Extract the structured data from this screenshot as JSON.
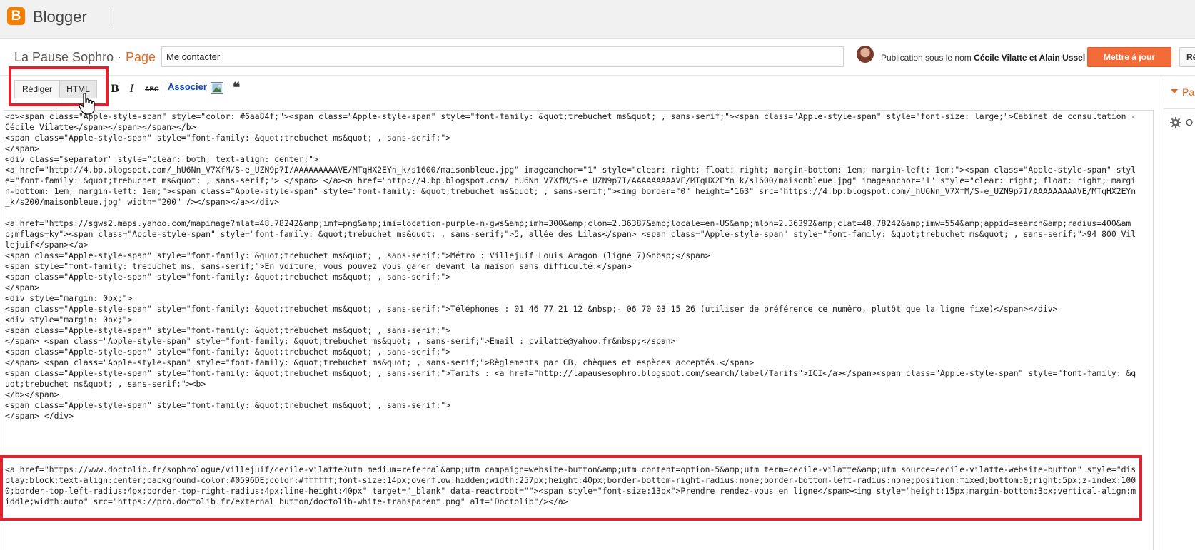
{
  "app": {
    "name": "Blogger",
    "logo_letter": "B"
  },
  "header": {
    "blog_title": "La Pause Sophro",
    "separator": "·",
    "page_label": "Page",
    "page_title_value": "Me contacter",
    "publishing_prefix": "Publication sous le nom ",
    "authors": "Cécile Vilatte et Alain Ussel",
    "update_button": "Mettre à jour",
    "revert_button": "Rétablir"
  },
  "toolbar": {
    "compose_label": "Rédiger",
    "html_label": "HTML",
    "bold": "B",
    "italic": "I",
    "strike": "ABC",
    "link_label": "Associer",
    "quote": "❝"
  },
  "sidebar": {
    "section_label": "Pa",
    "options_label": "O"
  },
  "editor": {
    "html_source_top": "<p><span class=\"Apple-style-span\" style=\"color: #6aa84f;\"><span class=\"Apple-style-span\" style=\"font-family: &quot;trebuchet ms&quot; , sans-serif;\"><span class=\"Apple-style-span\" style=\"font-size: large;\">Cabinet de consultation - Cécile Vilatte</span></span></span></b>\n<span class=\"Apple-style-span\" style=\"font-family: &quot;trebuchet ms&quot; , sans-serif;\">\n</span>\n<div class=\"separator\" style=\"clear: both; text-align: center;\">\n<a href=\"http://4.bp.blogspot.com/_hU6Nn_V7XfM/S-e_UZN9p7I/AAAAAAAAAVE/MTqHX2EYn_k/s1600/maisonbleue.jpg\" imageanchor=\"1\" style=\"clear: right; float: right; margin-bottom: 1em; margin-left: 1em;\"><span class=\"Apple-style-span\" style=\"font-family: &quot;trebuchet ms&quot; , sans-serif;\"> </span> </a><a href=\"http://4.bp.blogspot.com/_hU6Nn_V7XfM/S-e_UZN9p7I/AAAAAAAAAVE/MTqHX2EYn_k/s1600/maisonbleue.jpg\" imageanchor=\"1\" style=\"clear: right; float: right; margin-bottom: 1em; margin-left: 1em;\"><span class=\"Apple-style-span\" style=\"font-family: &quot;trebuchet ms&quot; , sans-serif;\"><img border=\"0\" height=\"163\" src=\"https://4.bp.blogspot.com/_hU6Nn_V7XfM/S-e_UZN9p7I/AAAAAAAAAVE/MTqHX2EYn_k/s200/maisonbleue.jpg\" width=\"200\" /></span></a></div>\n\n<a href=\"https://sgws2.maps.yahoo.com/mapimage?mlat=48.78242&amp;imf=png&amp;imi=location-purple-n-gws&amp;imh=300&amp;clon=2.36387&amp;locale=en-US&amp;mlon=2.36392&amp;clat=48.78242&amp;imw=554&amp;appid=search&amp;radius=400&amp;mflags=ky\"><span class=\"Apple-style-span\" style=\"font-family: &quot;trebuchet ms&quot; , sans-serif;\">5, allée des Lilas</span> <span class=\"Apple-style-span\" style=\"font-family: &quot;trebuchet ms&quot; , sans-serif;\">94 800 Villejuif</span></a>\n<span class=\"Apple-style-span\" style=\"font-family: &quot;trebuchet ms&quot; , sans-serif;\">Métro : Villejuif Louis Aragon (ligne 7)&nbsp;</span>\n<span style=\"font-family: trebuchet ms, sans-serif;\">En voiture, vous pouvez vous garer devant la maison sans difficulté.</span>\n<span class=\"Apple-style-span\" style=\"font-family: &quot;trebuchet ms&quot; , sans-serif;\">\n</span>\n<div style=\"margin: 0px;\">\n<span class=\"Apple-style-span\" style=\"font-family: &quot;trebuchet ms&quot; , sans-serif;\">Téléphones : 01 46 77 21 12 &nbsp;- 06 70 03 15 26 (utiliser de préférence ce numéro, plutôt que la ligne fixe)</span></div>\n<div style=\"margin: 0px;\">\n<span class=\"Apple-style-span\" style=\"font-family: &quot;trebuchet ms&quot; , sans-serif;\">\n</span> <span class=\"Apple-style-span\" style=\"font-family: &quot;trebuchet ms&quot; , sans-serif;\">Email : cvilatte@yahoo.fr&nbsp;</span>\n<span class=\"Apple-style-span\" style=\"font-family: &quot;trebuchet ms&quot; , sans-serif;\">\n</span> <span class=\"Apple-style-span\" style=\"font-family: &quot;trebuchet ms&quot; , sans-serif;\">Règlements par CB, chèques et espèces acceptés.</span>\n<span class=\"Apple-style-span\" style=\"font-family: &quot;trebuchet ms&quot; , sans-serif;\">Tarifs : <a href=\"http://lapausesophro.blogspot.com/search/label/Tarifs\">ICI</a></span><span class=\"Apple-style-span\" style=\"font-family: &quot;trebuchet ms&quot; , sans-serif;\"><b>\n</b></span>\n<span class=\"Apple-style-span\" style=\"font-family: &quot;trebuchet ms&quot; , sans-serif;\">\n</span> </div>",
    "html_source_bottom": "<a href=\"https://www.doctolib.fr/sophrologue/villejuif/cecile-vilatte?utm_medium=referral&amp;utm_campaign=website-button&amp;utm_content=option-5&amp;utm_term=cecile-vilatte&amp;utm_source=cecile-vilatte-website-button\" style=\"display:block;text-align:center;background-color:#0596DE;color:#ffffff;font-size:14px;overflow:hidden;width:257px;height:40px;border-bottom-right-radius:none;border-bottom-left-radius:none;position:fixed;bottom:0;right:5px;z-index:1000;border-top-left-radius:4px;border-top-right-radius:4px;line-height:40px\" target=\"_blank\" data-reactroot=\"\"><span style=\"font-size:13px\">Prendre rendez-vous en ligne</span><img style=\"height:15px;margin-bottom:3px;vertical-align:middle;width:auto\" src=\"https://pro.doctolib.fr/external_button/doctolib-white-transparent.png\" alt=\"Doctolib\"/></a>"
  },
  "colors": {
    "brand_orange": "#f57d00",
    "update_button": "#f36b39",
    "highlight_red": "#e0222e",
    "page_accent": "#e9661a",
    "link_blue": "#1a47b8"
  },
  "icons": {
    "logo": "blogger-logo-icon",
    "image": "insert-image-icon",
    "quote": "quote-icon",
    "cursor": "hand-cursor-icon",
    "gear": "gear-icon",
    "arrow": "chevron-down-icon"
  }
}
